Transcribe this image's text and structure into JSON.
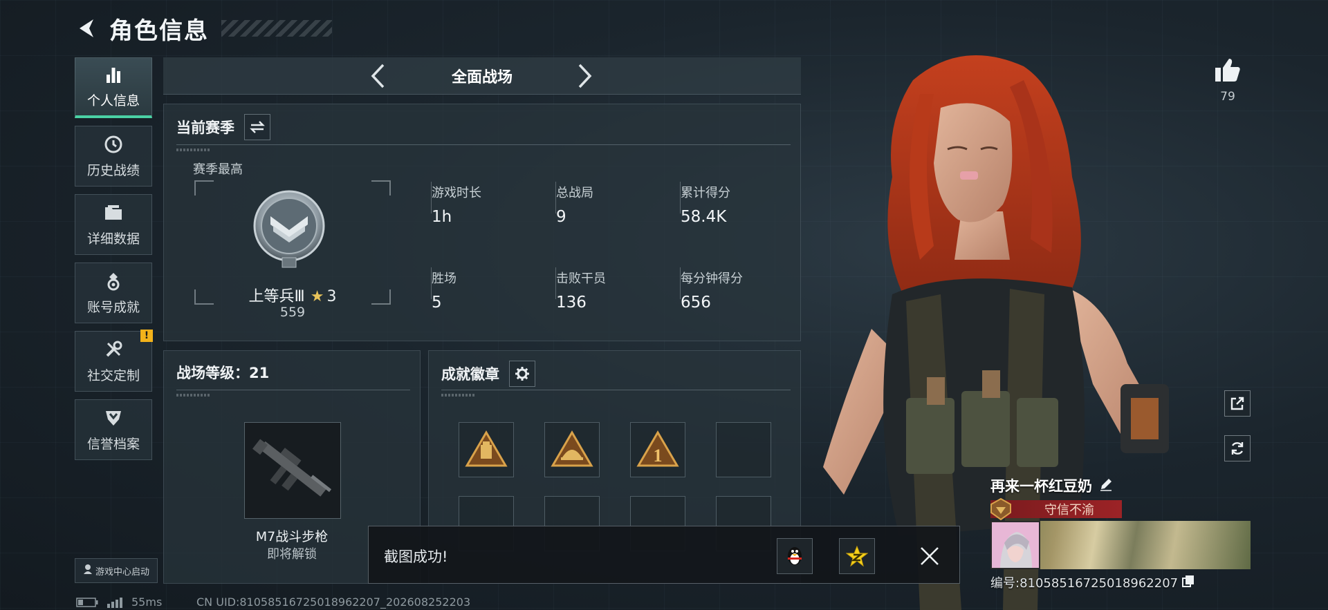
{
  "header": {
    "title": "角色信息"
  },
  "nav": {
    "items": [
      {
        "label": "个人信息",
        "icon": "bar-chart-icon",
        "active": true
      },
      {
        "label": "历史战绩",
        "icon": "history-clock-icon"
      },
      {
        "label": "详细数据",
        "icon": "folder-icon"
      },
      {
        "label": "账号成就",
        "icon": "achievement-medal-icon"
      },
      {
        "label": "社交定制",
        "icon": "tools-icon",
        "badge": "!"
      },
      {
        "label": "信誉档案",
        "icon": "shield-badge-icon"
      }
    ],
    "launch_label": "游戏中心启动"
  },
  "mode_bar": {
    "title": "全面战场"
  },
  "season": {
    "title": "当前赛季",
    "best_label": "赛季最高",
    "rank_name": "上等兵Ⅲ",
    "rank_stars": "3",
    "rank_score": "559",
    "stats": [
      {
        "label": "游戏时长",
        "value": "1h"
      },
      {
        "label": "总战局",
        "value": "9"
      },
      {
        "label": "累计得分",
        "value": "58.4K"
      },
      {
        "label": "胜场",
        "value": "5"
      },
      {
        "label": "击败干员",
        "value": "136"
      },
      {
        "label": "每分钟得分",
        "value": "656"
      }
    ]
  },
  "level": {
    "title": "战场等级：21",
    "weapon_name": "M7战斗步枪",
    "weapon_status": "即将解锁"
  },
  "badges": {
    "title": "成就徽章",
    "unlocked_marks": [
      "",
      "",
      "1"
    ]
  },
  "toast": {
    "message": "截图成功!"
  },
  "status": {
    "ping": "55ms",
    "uid_line": "CN UID:810585167250189622​07_202608252203"
  },
  "likes": {
    "count": "79"
  },
  "player": {
    "name": "再来一杯红豆奶",
    "title": "守信不渝",
    "id_line": "编号:810585167250189622​07"
  },
  "colors": {
    "accent": "#4bd1a4",
    "warning": "#f2b21a",
    "title_red": "#9c2326",
    "gold": "#c8a24a"
  }
}
